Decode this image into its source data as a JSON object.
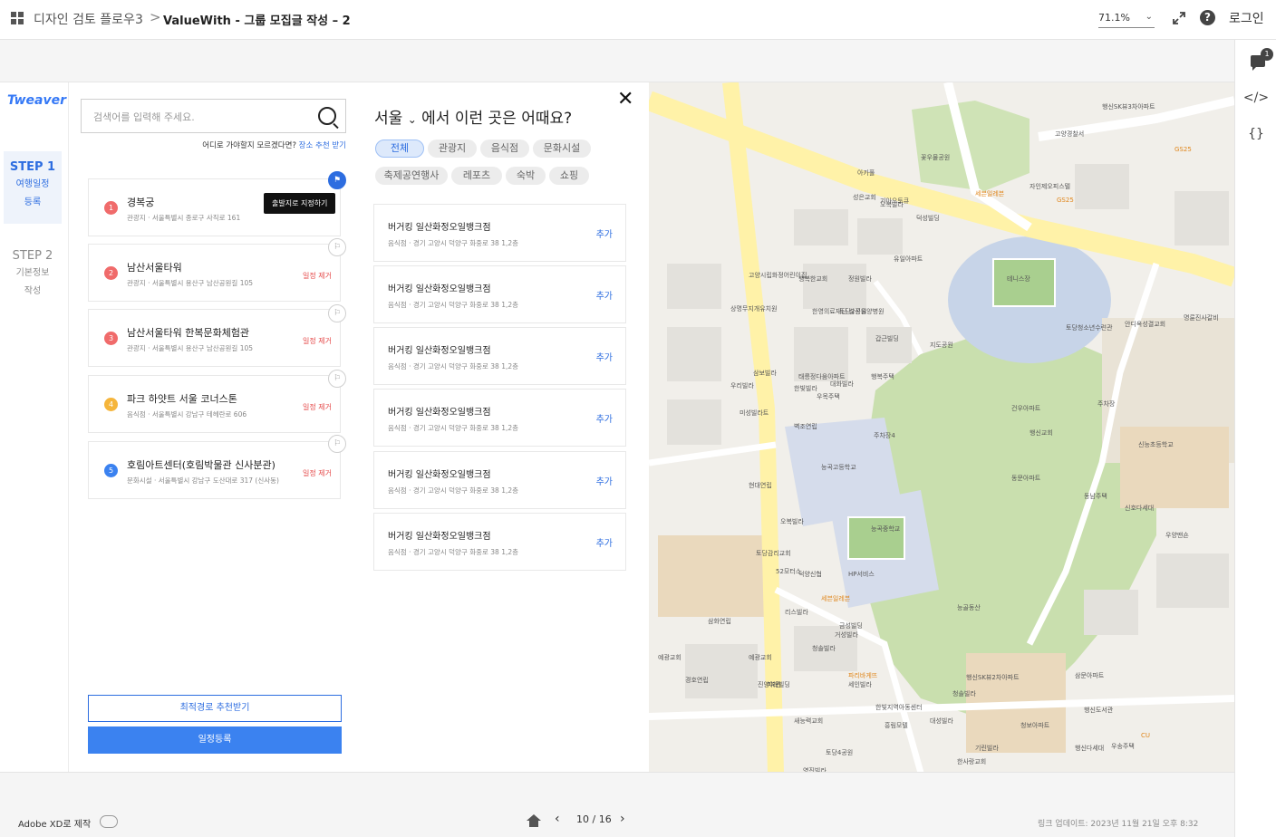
{
  "topbar": {
    "project": "디자인 검토 플로우3",
    "separator": ">",
    "page_title": "ValueWith - 그룹 모집글 작성 – 2",
    "zoom": "71.1%",
    "login": "로그인"
  },
  "app": {
    "logo": "Tweaver",
    "steps": [
      {
        "title": "STEP 1",
        "line1": "여행일정",
        "line2": "등록"
      },
      {
        "title": "STEP 2",
        "line1": "기본정보",
        "line2": "작성"
      }
    ]
  },
  "schedule": {
    "search_placeholder": "검색어를 입력해 주세요.",
    "hint": "어디로 가야할지 모르겠다면?",
    "hint_link": "장소 추천 받기",
    "tooltip": "출발지로 지정하기",
    "items": [
      {
        "num": "1",
        "name": "경복궁",
        "address": "관광지 · 서울특별시 종로구 사직로 161",
        "remove": "",
        "color": "#f06b6b"
      },
      {
        "num": "2",
        "name": "남산서울타워",
        "address": "관광지 · 서울특별시 용산구 남산공원길 105",
        "remove": "일정 제거",
        "color": "#f06b6b"
      },
      {
        "num": "3",
        "name": "남산서울타워 한복문화체험관",
        "address": "관광지 · 서울특별시 용산구 남산공원길 105",
        "remove": "일정 제거",
        "color": "#f06b6b"
      },
      {
        "num": "4",
        "name": "파크 하얏트 서울 코너스톤",
        "address": "음식점 · 서울특별시 강남구 테헤란로 606",
        "remove": "일정 제거",
        "color": "#f5b53b"
      },
      {
        "num": "5",
        "name": "호림아트센터(호림박물관 신사분관)",
        "address": "문화시설 · 서울특별시 강남구 도산대로 317 (신사동)",
        "remove": "일정 제거",
        "color": "#3b82f0"
      }
    ],
    "route_button": "최적경로 추천받기",
    "register_button": "일정등록"
  },
  "recommend": {
    "city": "서울",
    "caret": "⌄",
    "title": "에서 이런 곳은 어때요?",
    "close": "✕",
    "chips": [
      "전체",
      "관광지",
      "음식점",
      "문화시설",
      "축제공연행사",
      "레포츠",
      "숙박",
      "쇼핑"
    ],
    "items": [
      {
        "name": "버거킹 일산화정오일뱅크점",
        "address": "음식점 · 경기 고양시 덕양구 화중로 38 1,2층",
        "add": "추가"
      },
      {
        "name": "버거킹 일산화정오일뱅크점",
        "address": "음식점 · 경기 고양시 덕양구 화중로 38 1,2층",
        "add": "추가"
      },
      {
        "name": "버거킹 일산화정오일뱅크점",
        "address": "음식점 · 경기 고양시 덕양구 화중로 38 1,2층",
        "add": "추가"
      },
      {
        "name": "버거킹 일산화정오일뱅크점",
        "address": "음식점 · 경기 고양시 덕양구 화중로 38 1,2층",
        "add": "추가"
      },
      {
        "name": "버거킹 일산화정오일뱅크점",
        "address": "음식점 · 경기 고양시 덕양구 화중로 38 1,2층",
        "add": "추가"
      },
      {
        "name": "버거킹 일산화정오일뱅크점",
        "address": "음식점 · 경기 고양시 덕양구 화중로 38 1,2층",
        "add": "추가"
      }
    ]
  },
  "map": {
    "labels": [
      "고양경찰서",
      "꽃우물공원",
      "세븐일레븐",
      "아카풀",
      "자인제오피스텔",
      "기아오토큐",
      "GS25",
      "덕성빌딩",
      "유일아파트",
      "테니스장",
      "토당청소년수련관",
      "지도공원",
      "안디옥성결교회",
      "명륜진사갈비",
      "주차장",
      "주차장4",
      "건우아파트",
      "행신교회",
      "신능초등학교",
      "능곡고등학교",
      "능곡중학교",
      "동문아파트",
      "동남주택",
      "신호다세대",
      "우양맨숀",
      "능골동산",
      "세븐일레븐",
      "금성빌딩",
      "청솔빌라",
      "예광교회",
      "미래빌딩",
      "새능력교회",
      "파리바게뜨",
      "한빛지역아동센터",
      "삼문아파트",
      "행신SK뷰2차아파트",
      "행신도서관",
      "행신SK뷰3차아파트",
      "고양시립화정어린이집",
      "행복한교회",
      "정원빌라",
      "상명무지개유치원",
      "한영의료재단 삼성요양병원",
      "토당2공원",
      "갑근빌딩",
      "삼보빌라",
      "태릉정다움아파트",
      "대화빌라",
      "행복주택",
      "한빛빌라",
      "우목주택",
      "벽조연립",
      "우리빌라",
      "현대연립",
      "오복빌라",
      "토당감리교회",
      "52모터스",
      "덕양신협",
      "HP서비스",
      "리스빌라",
      "거성빌라",
      "삼화연립",
      "예광교회",
      "경호연립",
      "진양여관",
      "세인빌라",
      "흥림모텔",
      "청솔빌라",
      "토당4공원",
      "기린빌라",
      "대성빌라",
      "청보아파트",
      "한사랑교회",
      "행신다세대",
      "우송주택",
      "영진빌라",
      "미성빌라트",
      "성은교회",
      "오복빌라",
      "CU",
      "GS25"
    ]
  },
  "rail": {
    "badge": "1",
    "code_icon": "</>",
    "braces_icon": "{}"
  },
  "bottombar": {
    "made_with": "Adobe XD로 제작",
    "page": "10 / 16",
    "updated": "링크 업데이트: 2023년 11월 21일 오후 8:32"
  }
}
